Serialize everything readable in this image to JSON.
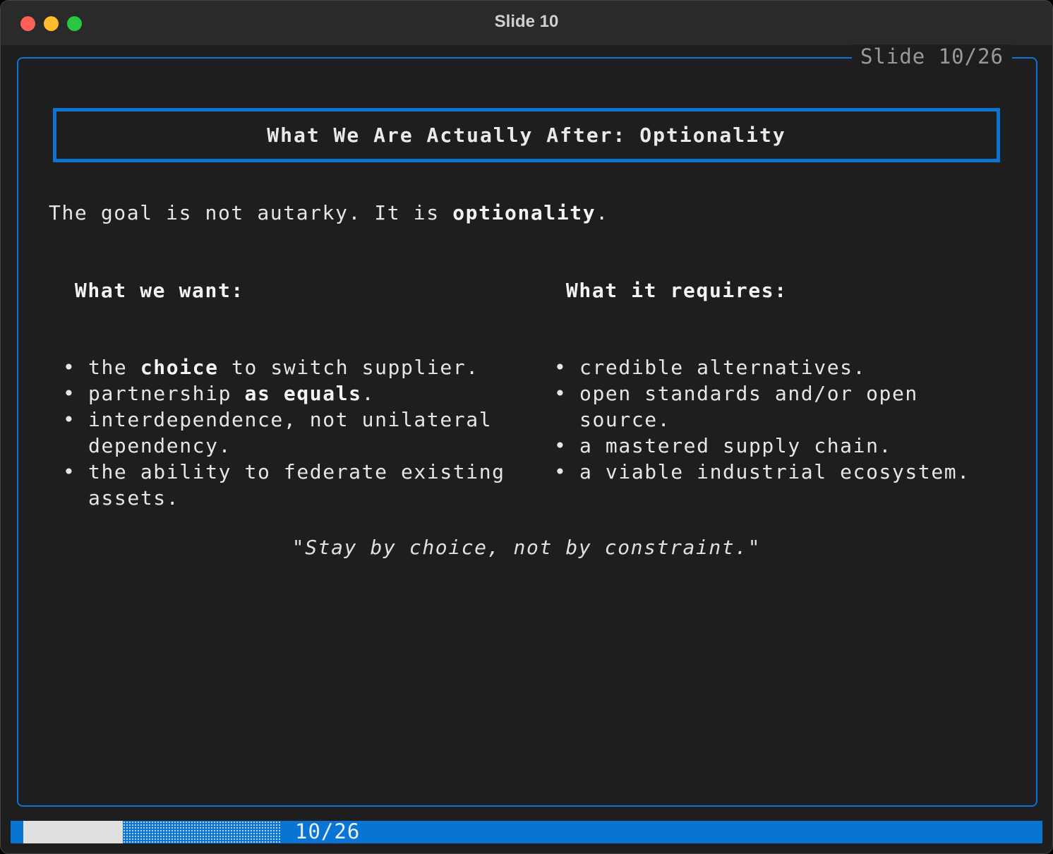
{
  "window": {
    "title": "Slide 10"
  },
  "frame": {
    "label": "Slide 10/26"
  },
  "slide": {
    "title": "What We Are Actually After: Optionality",
    "intro": {
      "pre": "The goal is not autarky. It is ",
      "bold": "optionality",
      "post": "."
    },
    "left": {
      "heading": "What we want:",
      "items": [
        {
          "pre": "the ",
          "bold": "choice",
          "post": " to switch supplier."
        },
        {
          "pre": "partnership ",
          "bold": "as equals",
          "post": "."
        },
        {
          "pre": "interdependence, not unilateral\ndependency.",
          "bold": "",
          "post": ""
        },
        {
          "pre": "the ability to federate existing\nassets.",
          "bold": "",
          "post": ""
        }
      ]
    },
    "right": {
      "heading": "What it requires:",
      "items": [
        "credible alternatives.",
        "open standards and/or open\nsource.",
        "a mastered supply chain.",
        "a viable industrial ecosystem."
      ]
    },
    "quote": "\"Stay by choice, not by constraint.\""
  },
  "status": {
    "page": "10/26",
    "progress": 0.385
  },
  "colors": {
    "accent": "#0a74d4"
  }
}
